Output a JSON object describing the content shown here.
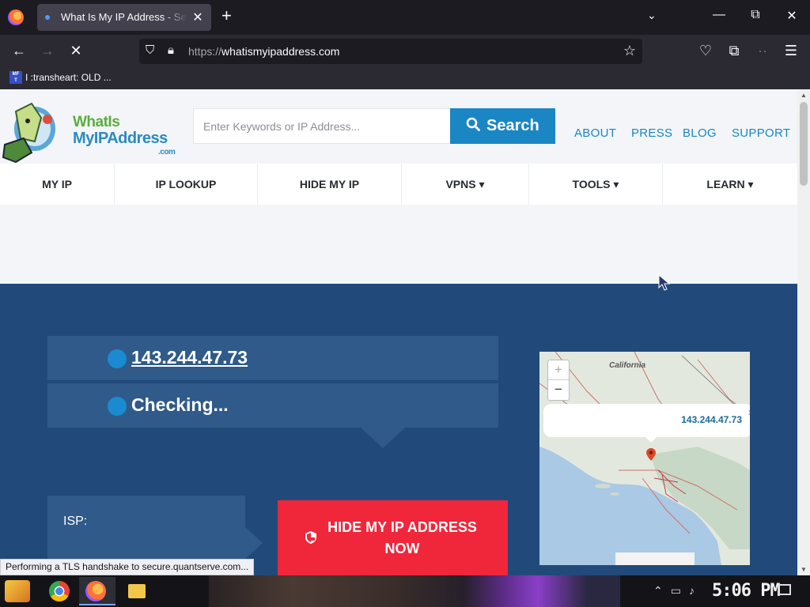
{
  "browser": {
    "tab_title": "What Is My IP Address - See Your Public IP Address",
    "tab_close": "✕",
    "new_tab": "+",
    "tab_list": "⌄",
    "win_min": "—",
    "win_max": "⧉",
    "win_close": "✕",
    "url_protocol": "https://",
    "url_host": "whatismyipaddress.com",
    "bookmark_label": "I :transheart: OLD ..."
  },
  "site": {
    "logo_line1": "WhatIs",
    "logo_line2": "MyIPAddress",
    "logo_line3": ".com",
    "search_placeholder": "Enter Keywords or IP Address...",
    "search_button": "Search",
    "top_links": [
      "ABOUT",
      "PRESS",
      "BLOG",
      "SUPPORT"
    ],
    "nav": [
      "MY IP",
      "IP LOOKUP",
      "HIDE MY IP",
      "VPNS ▾",
      "TOOLS ▾",
      "LEARN ▾"
    ]
  },
  "hero": {
    "ip_address": "143.244.47.73",
    "ipv6_status": "Checking...",
    "isp_label": "ISP:",
    "hide_button_line1": "HIDE MY IP ADDRESS",
    "hide_button_line2": "NOW"
  },
  "map": {
    "region_label": "California",
    "popup_ip": "143.244.47.73",
    "zoom_in": "+",
    "zoom_out": "−"
  },
  "status_text": "Performing a TLS handshake to secure.quantserve.com...",
  "taskbar": {
    "clock": "5:06 PM"
  },
  "colors": {
    "brand_blue": "#1a86c4",
    "hero_bg": "#214a7a",
    "cta_red": "#f0263a",
    "logo_green": "#5aae3c"
  }
}
